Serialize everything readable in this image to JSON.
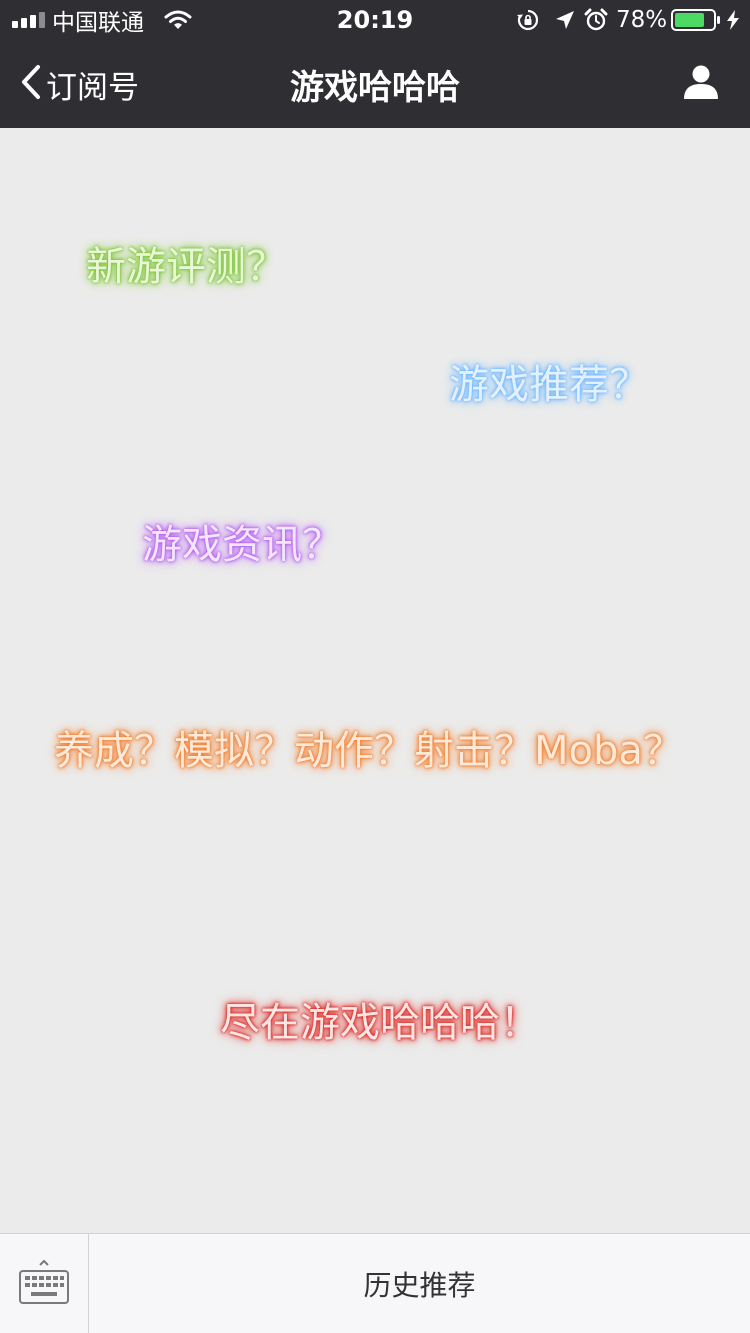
{
  "status_bar": {
    "carrier": "中国联通",
    "time": "20:19",
    "battery_percent": "78%",
    "battery_level": 0.78,
    "icons": [
      "signal-icon",
      "wifi-icon",
      "rotation-lock-icon",
      "location-arrow-icon",
      "alarm-icon",
      "battery-icon",
      "charging-bolt-icon"
    ]
  },
  "nav": {
    "back_label": "订阅号",
    "title": "游戏哈哈哈",
    "back_icon": "chevron-left-icon",
    "profile_icon": "person-icon"
  },
  "content": {
    "lines": [
      {
        "text": "新游评测？",
        "color": "#7cc13a"
      },
      {
        "text": "游戏推荐？",
        "color": "#6cb4ff"
      },
      {
        "text": "游戏资讯？",
        "color": "#b256f0"
      },
      {
        "text": "养成？模拟？动作？射击？Moba？",
        "color": "#f07a2a"
      },
      {
        "text": "尽在游戏哈哈哈！",
        "color": "#d9221c"
      }
    ]
  },
  "bottom_bar": {
    "keyboard_icon": "keyboard-icon",
    "menu_label": "历史推荐"
  },
  "colors": {
    "bar_background": "#2f2f33",
    "page_background": "#ebebeb",
    "battery_green": "#4cd964"
  }
}
